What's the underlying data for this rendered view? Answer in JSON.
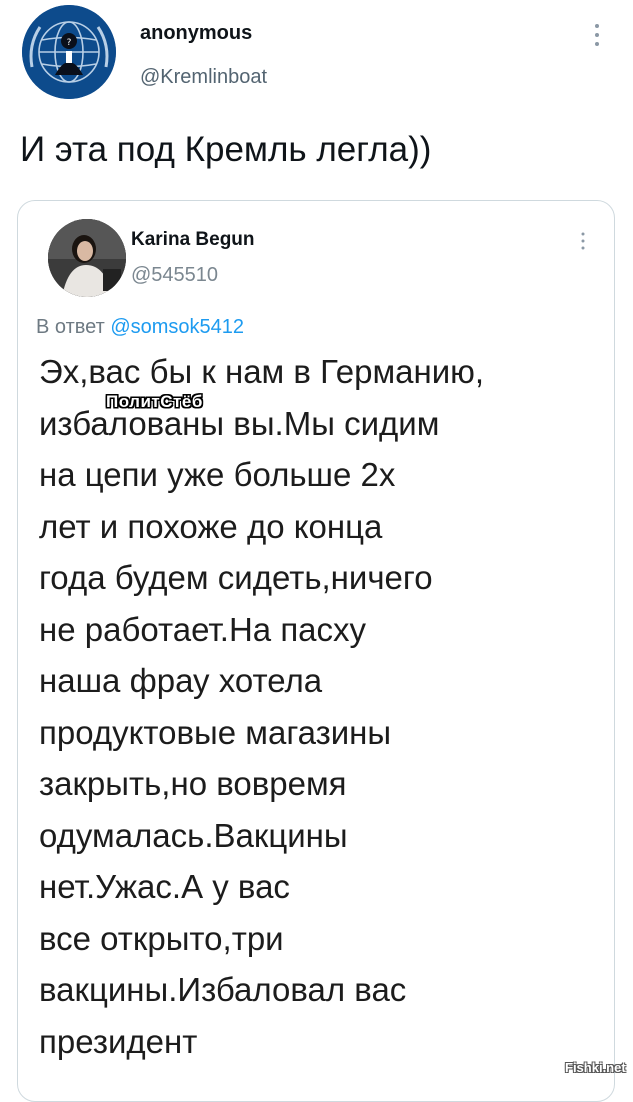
{
  "tweet": {
    "author_name": "anonymous",
    "author_handle": "@Kremlinboat",
    "text": "И эта под Кремль легла))",
    "avatar_icon": "anonymous-globe-logo-icon",
    "more_icon": "vertical-dots-icon"
  },
  "quoted_tweet": {
    "author_name": "Karina Begun",
    "author_handle": "@545510",
    "reply_prefix": "В ответ",
    "reply_mention": "@somsok5412",
    "more_icon": "vertical-dots-icon",
    "body_lines": [
      "Эх,вас бы к нам в Германию,",
      "избалованы вы.Мы сидим",
      "на цепи уже больше 2х",
      "лет и похоже до конца",
      "года будем сидеть,ничего",
      "не работает.На пасху",
      "наша фрау хотела",
      "продуктовые магазины",
      "закрыть,но вовремя",
      "одумалась.Вакцины",
      "нет.Ужас.А у вас",
      "все открыто,три",
      "вакцины.Избаловал вас",
      "президент"
    ]
  },
  "watermarks": {
    "overlay": "ПолитСтёб",
    "site": "Fishki.net"
  },
  "colors": {
    "text": "#0f1419",
    "muted": "#536471",
    "link": "#1d9bf0",
    "border": "#cfd9de"
  }
}
